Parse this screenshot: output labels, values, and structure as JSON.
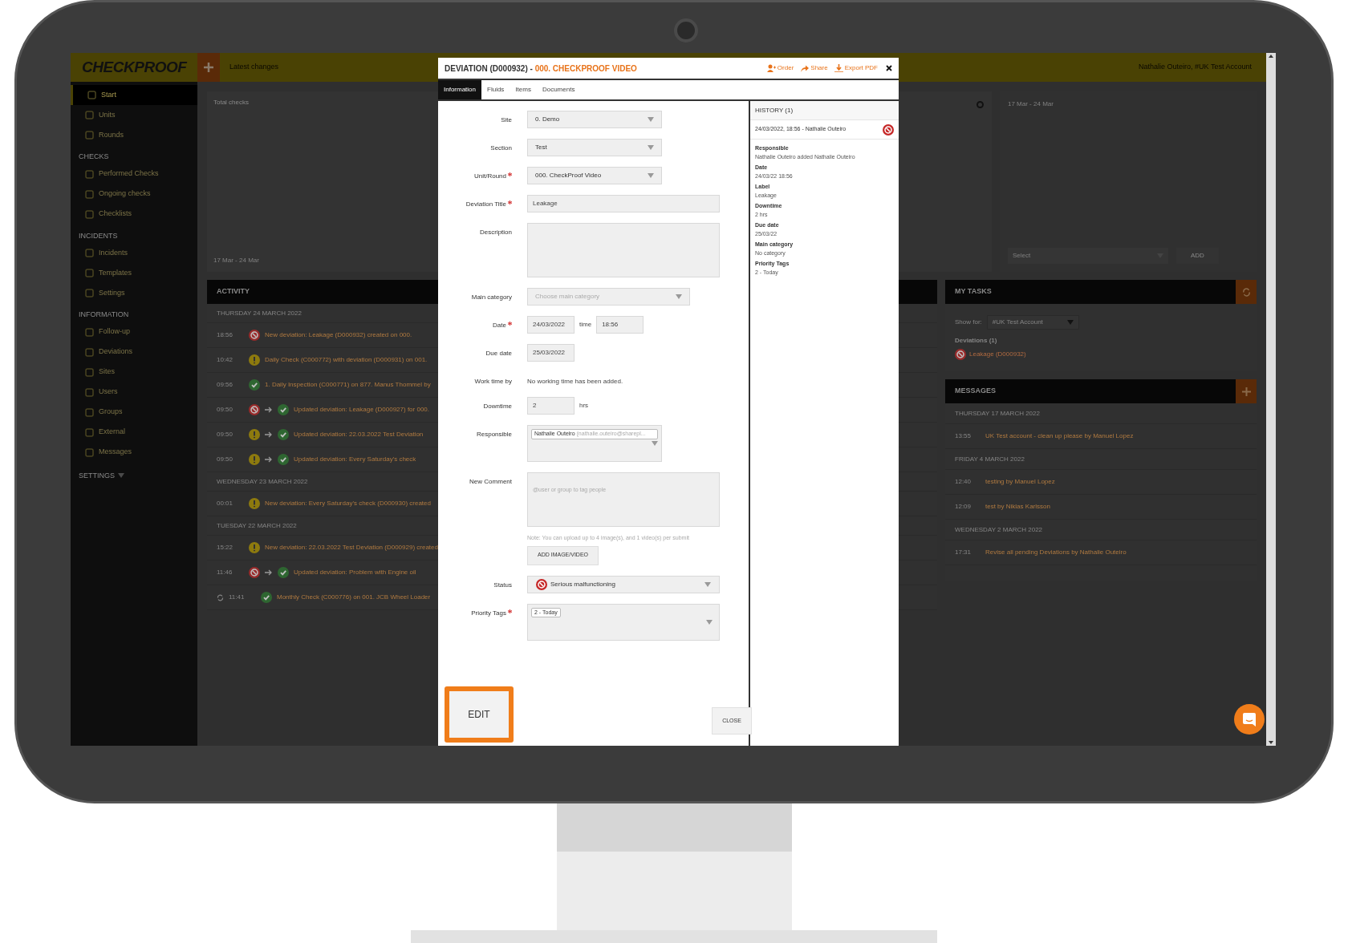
{
  "app": {
    "logo": "CHECKPROOF",
    "header_link": "Latest changes",
    "user": "Nathalie Outeiro, #UK Test Account"
  },
  "sidebar": {
    "items": [
      {
        "label": "Start",
        "selected": true
      },
      {
        "label": "Units",
        "selected": false
      },
      {
        "label": "Rounds",
        "selected": false
      }
    ],
    "sections": [
      {
        "title": "CHECKS",
        "items": [
          {
            "label": "Performed Checks",
            "selected": false
          },
          {
            "label": "Ongoing checks",
            "selected": false
          },
          {
            "label": "Checklists",
            "selected": false
          }
        ]
      },
      {
        "title": "INCIDENTS",
        "items": [
          {
            "label": "Incidents",
            "selected": false
          },
          {
            "label": "Templates",
            "selected": false
          },
          {
            "label": "Settings",
            "selected": false
          }
        ]
      },
      {
        "title": "INFORMATION",
        "items": [
          {
            "label": "Follow-up",
            "selected": false
          },
          {
            "label": "Deviations",
            "selected": false
          },
          {
            "label": "Sites",
            "selected": false
          },
          {
            "label": "Users",
            "selected": false
          },
          {
            "label": "Groups",
            "selected": false
          },
          {
            "label": "External",
            "selected": false
          },
          {
            "label": "Messages",
            "selected": false
          }
        ]
      }
    ],
    "settings": "SETTINGS"
  },
  "dashboard": {
    "total_checks": {
      "title": "Total checks",
      "footer": "17 Mar - 24 Mar"
    },
    "range": {
      "date_range": "17 Mar - 24 Mar",
      "select_placeholder": "Select",
      "add": "ADD"
    }
  },
  "activity": {
    "title": "ACTIVITY",
    "groups": [
      {
        "date": "THURSDAY 24 MARCH 2022",
        "rows": [
          {
            "time": "18:56",
            "statuses": [
              {
                "kind": "deviation"
              }
            ],
            "text": "New deviation: Leakage (D000932) created on 000."
          },
          {
            "time": "10:42",
            "statuses": [
              {
                "kind": "warning"
              }
            ],
            "text": "Daily Check (C000772) with deviation (D000931) on 001."
          },
          {
            "time": "09:56",
            "statuses": [
              {
                "kind": "ok"
              }
            ],
            "text": "1. Daily Inspection (C000771) on 877. Manus Thommel by"
          },
          {
            "time": "09:50",
            "statuses": [
              {
                "kind": "deviation"
              },
              {
                "kind": "ok"
              }
            ],
            "text": "Updated deviation: Leakage (D000927) for 000."
          },
          {
            "time": "09:50",
            "statuses": [
              {
                "kind": "warning"
              },
              {
                "kind": "ok"
              }
            ],
            "text": "Updated deviation: 22.03.2022 Test Deviation"
          },
          {
            "time": "09:50",
            "statuses": [
              {
                "kind": "warning"
              },
              {
                "kind": "ok"
              }
            ],
            "text": "Updated deviation: Every Saturday's check"
          }
        ]
      },
      {
        "date": "WEDNESDAY 23 MARCH 2022",
        "rows": [
          {
            "time": "00:01",
            "statuses": [
              {
                "kind": "warning"
              }
            ],
            "text": "New deviation: Every Saturday's check (D000930) created"
          }
        ]
      },
      {
        "date": "TUESDAY 22 MARCH 2022",
        "rows": [
          {
            "time": "15:22",
            "statuses": [
              {
                "kind": "warning"
              }
            ],
            "text": "New deviation: 22.03.2022 Test Deviation (D000929) created"
          },
          {
            "time": "11:46",
            "statuses": [
              {
                "kind": "deviation"
              },
              {
                "kind": "ok"
              }
            ],
            "text": "Updated deviation: Problem with Engine oil"
          },
          {
            "time": "11:41",
            "statuses": [
              {
                "kind": "ok"
              }
            ],
            "recurring": true,
            "text": "Monthly Check (C000776) on 001. JCB Wheel Loader"
          }
        ]
      }
    ]
  },
  "my_tasks": {
    "title": "MY TASKS",
    "show_for_label": "Show for:",
    "show_for": "#UK Test Account",
    "deviations_title": "Deviations (1)",
    "deviations": [
      "Leakage (D000932)"
    ]
  },
  "messages": {
    "title": "MESSAGES",
    "groups": [
      {
        "date": "THURSDAY 17 MARCH 2022",
        "rows": [
          {
            "time": "13:55",
            "text": "UK Test account - clean up please by Manuel Lopez"
          }
        ]
      },
      {
        "date": "FRIDAY 4 MARCH 2022",
        "rows": [
          {
            "time": "12:40",
            "text": "testing by Manuel Lopez"
          },
          {
            "time": "12:09",
            "text": "test by Niklas Karlsson"
          }
        ]
      },
      {
        "date": "WEDNESDAY 2 MARCH 2022",
        "rows": [
          {
            "time": "17:31",
            "text": "Revise all pending Deviations by Nathalie Outeiro"
          }
        ]
      }
    ]
  },
  "modal": {
    "title": "DEVIATION (D000932) - ",
    "title_link": "000. CHECKPROOF VIDEO",
    "actions": [
      "Order",
      "Share",
      "Export PDF"
    ],
    "tabs": [
      {
        "label": "Information",
        "selected": true
      },
      {
        "label": "Fluids",
        "selected": false
      },
      {
        "label": "Items",
        "selected": false
      },
      {
        "label": "Documents",
        "selected": false
      }
    ],
    "fields": [
      {
        "kind": "select",
        "label": "Site",
        "required": false,
        "value": "0. Demo"
      },
      {
        "kind": "select",
        "label": "Section",
        "required": false,
        "value": "Test"
      },
      {
        "kind": "select",
        "label": "Unit/Round",
        "required": true,
        "value": "000. CheckProof Video"
      },
      {
        "kind": "text",
        "label": "Deviation Title",
        "required": true,
        "value": "Leakage"
      },
      {
        "kind": "textarea",
        "label": "Description",
        "required": false
      },
      {
        "kind": "select_wide",
        "label": "Main category",
        "required": false,
        "placeholder": "Choose main category"
      },
      {
        "kind": "datetime",
        "label": "Date",
        "required": true,
        "value": "24/03/2022",
        "between": "time",
        "time": "18:56"
      },
      {
        "kind": "date",
        "label": "Due date",
        "required": false,
        "value": "25/03/2022"
      },
      {
        "kind": "note",
        "label": "Work time by",
        "required": false,
        "value": "No working time has been added."
      },
      {
        "kind": "number",
        "label": "Downtime",
        "required": false,
        "value": "2",
        "unit": "hrs"
      },
      {
        "kind": "people",
        "label": "Responsible",
        "required": false,
        "tag": "Nathalie Outeiro",
        "detail": "(nathalie.outeiro@sharepl..."
      },
      {
        "kind": "comment",
        "label": "New Comment",
        "required": false,
        "placeholder": "@user or group to tag people"
      },
      {
        "kind": "upload",
        "note": "Note: You can upload up to 4 image(s), and 1 video(s) per submit",
        "button": "ADD IMAGE/VIDEO"
      },
      {
        "kind": "status",
        "label": "Status",
        "required": false,
        "value": "Serious malfunctioning"
      },
      {
        "kind": "tags",
        "label": "Priority Tags",
        "required": true,
        "tag": "2 - Today"
      }
    ],
    "history": {
      "title": "HISTORY (1)",
      "entries": [
        {
          "header": "24/03/2022, 18:56 - Nathalie Outeiro",
          "details": [
            {
              "label": "Responsible",
              "value": "Nathalie Outeiro added Nathalie Outeiro"
            },
            {
              "label": "Date",
              "value": "24/03/22 18:56"
            },
            {
              "label": "Label",
              "value": "Leakage"
            },
            {
              "label": "Downtime",
              "value": "2 hrs"
            },
            {
              "label": "Due date",
              "value": "25/03/22"
            },
            {
              "label": "Main category",
              "value": "No category"
            },
            {
              "label": "Priority Tags",
              "value": "2 - Today"
            }
          ]
        }
      ]
    },
    "edit_button": "EDIT",
    "close_button": "CLOSE"
  }
}
